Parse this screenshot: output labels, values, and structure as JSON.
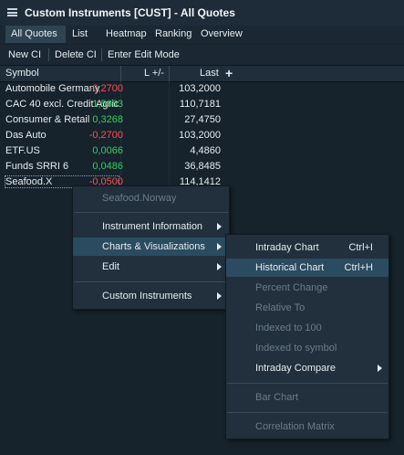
{
  "window": {
    "title": "Custom Instruments [CUST] - All Quotes"
  },
  "tabs": [
    {
      "label": "All Quotes",
      "active": true
    },
    {
      "label": "List"
    },
    {
      "label": "Heatmap"
    },
    {
      "label": "Ranking"
    },
    {
      "label": "Overview"
    }
  ],
  "toolbar": {
    "new_ci": "New CI",
    "delete_ci": "Delete CI",
    "edit_mode": "Enter Edit Mode"
  },
  "table": {
    "headers": {
      "symbol": "Symbol",
      "change": "L +/-",
      "last": "Last",
      "add": "+"
    },
    "rows": [
      {
        "symbol": "Automobile Germany",
        "change": "-0,2700",
        "last": "103,2000"
      },
      {
        "symbol": "CAC 40 excl. Credit Agricole",
        "change": "1,5663",
        "last": "110,7181"
      },
      {
        "symbol": "Consumer & Retail",
        "change": "0,3268",
        "last": "27,4750"
      },
      {
        "symbol": "Das Auto",
        "change": "-0,2700",
        "last": "103,2000"
      },
      {
        "symbol": "ETF.US",
        "change": "0,0066",
        "last": "4,4860"
      },
      {
        "symbol": "Funds SRRI 6",
        "change": "0,0486",
        "last": "36,8485"
      },
      {
        "symbol": "Seafood.X",
        "change": "-0,0500",
        "last": "114,1412"
      }
    ]
  },
  "context_menu": {
    "header": "Seafood.Norway",
    "items": {
      "instrument_information": "Instrument Information",
      "charts_visualizations": "Charts & Visualizations",
      "edit": "Edit",
      "custom_instruments": "Custom Instruments"
    }
  },
  "submenu": {
    "intraday_chart": {
      "label": "Intraday Chart",
      "shortcut": "Ctrl+I"
    },
    "historical_chart": {
      "label": "Historical Chart",
      "shortcut": "Ctrl+H"
    },
    "percent_change": "Percent Change",
    "relative_to": "Relative To",
    "indexed_to_100": "Indexed to 100",
    "indexed_to_symbol": "Indexed to symbol",
    "intraday_compare": "Intraday Compare",
    "bar_chart": "Bar Chart",
    "correlation_matrix": "Correlation Matrix"
  },
  "colors": {
    "negative": "#ff5050",
    "positive": "#34d160",
    "highlight": "#2b4b60",
    "background": "#16222c"
  },
  "icons": {
    "menu": "hamburger-icon",
    "submenu_arrow": "chevron-right-icon",
    "add_column": "plus-icon"
  }
}
